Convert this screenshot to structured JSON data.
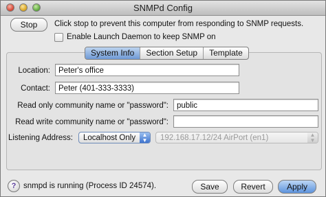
{
  "window": {
    "title": "SNMPd Config"
  },
  "top": {
    "stop_label": "Stop",
    "stop_note": "Click stop to prevent this computer from responding to SNMP requests.",
    "daemon_label": "Enable Launch Daemon to keep SNMP on",
    "daemon_checked": false
  },
  "tabs": [
    {
      "label": "System Info",
      "active": true
    },
    {
      "label": "Section Setup",
      "active": false
    },
    {
      "label": "Template",
      "active": false
    }
  ],
  "form": {
    "location_label": "Location:",
    "location_value": "Peter's office",
    "contact_label": "Contact:",
    "contact_value": "Peter (401-333-3333)",
    "ro_label": "Read only community name or \"password\":",
    "ro_value": "public",
    "rw_label": "Read write community name or \"password\":",
    "rw_value": "",
    "listen_label": "Listening Address:",
    "listen_selected": "Localhost Only",
    "interface_selected": "192.168.17.12/24 AirPort (en1)"
  },
  "footer": {
    "help_glyph": "?",
    "status": "snmpd is running (Process ID 24574).",
    "save_label": "Save",
    "revert_label": "Revert",
    "apply_label": "Apply"
  }
}
